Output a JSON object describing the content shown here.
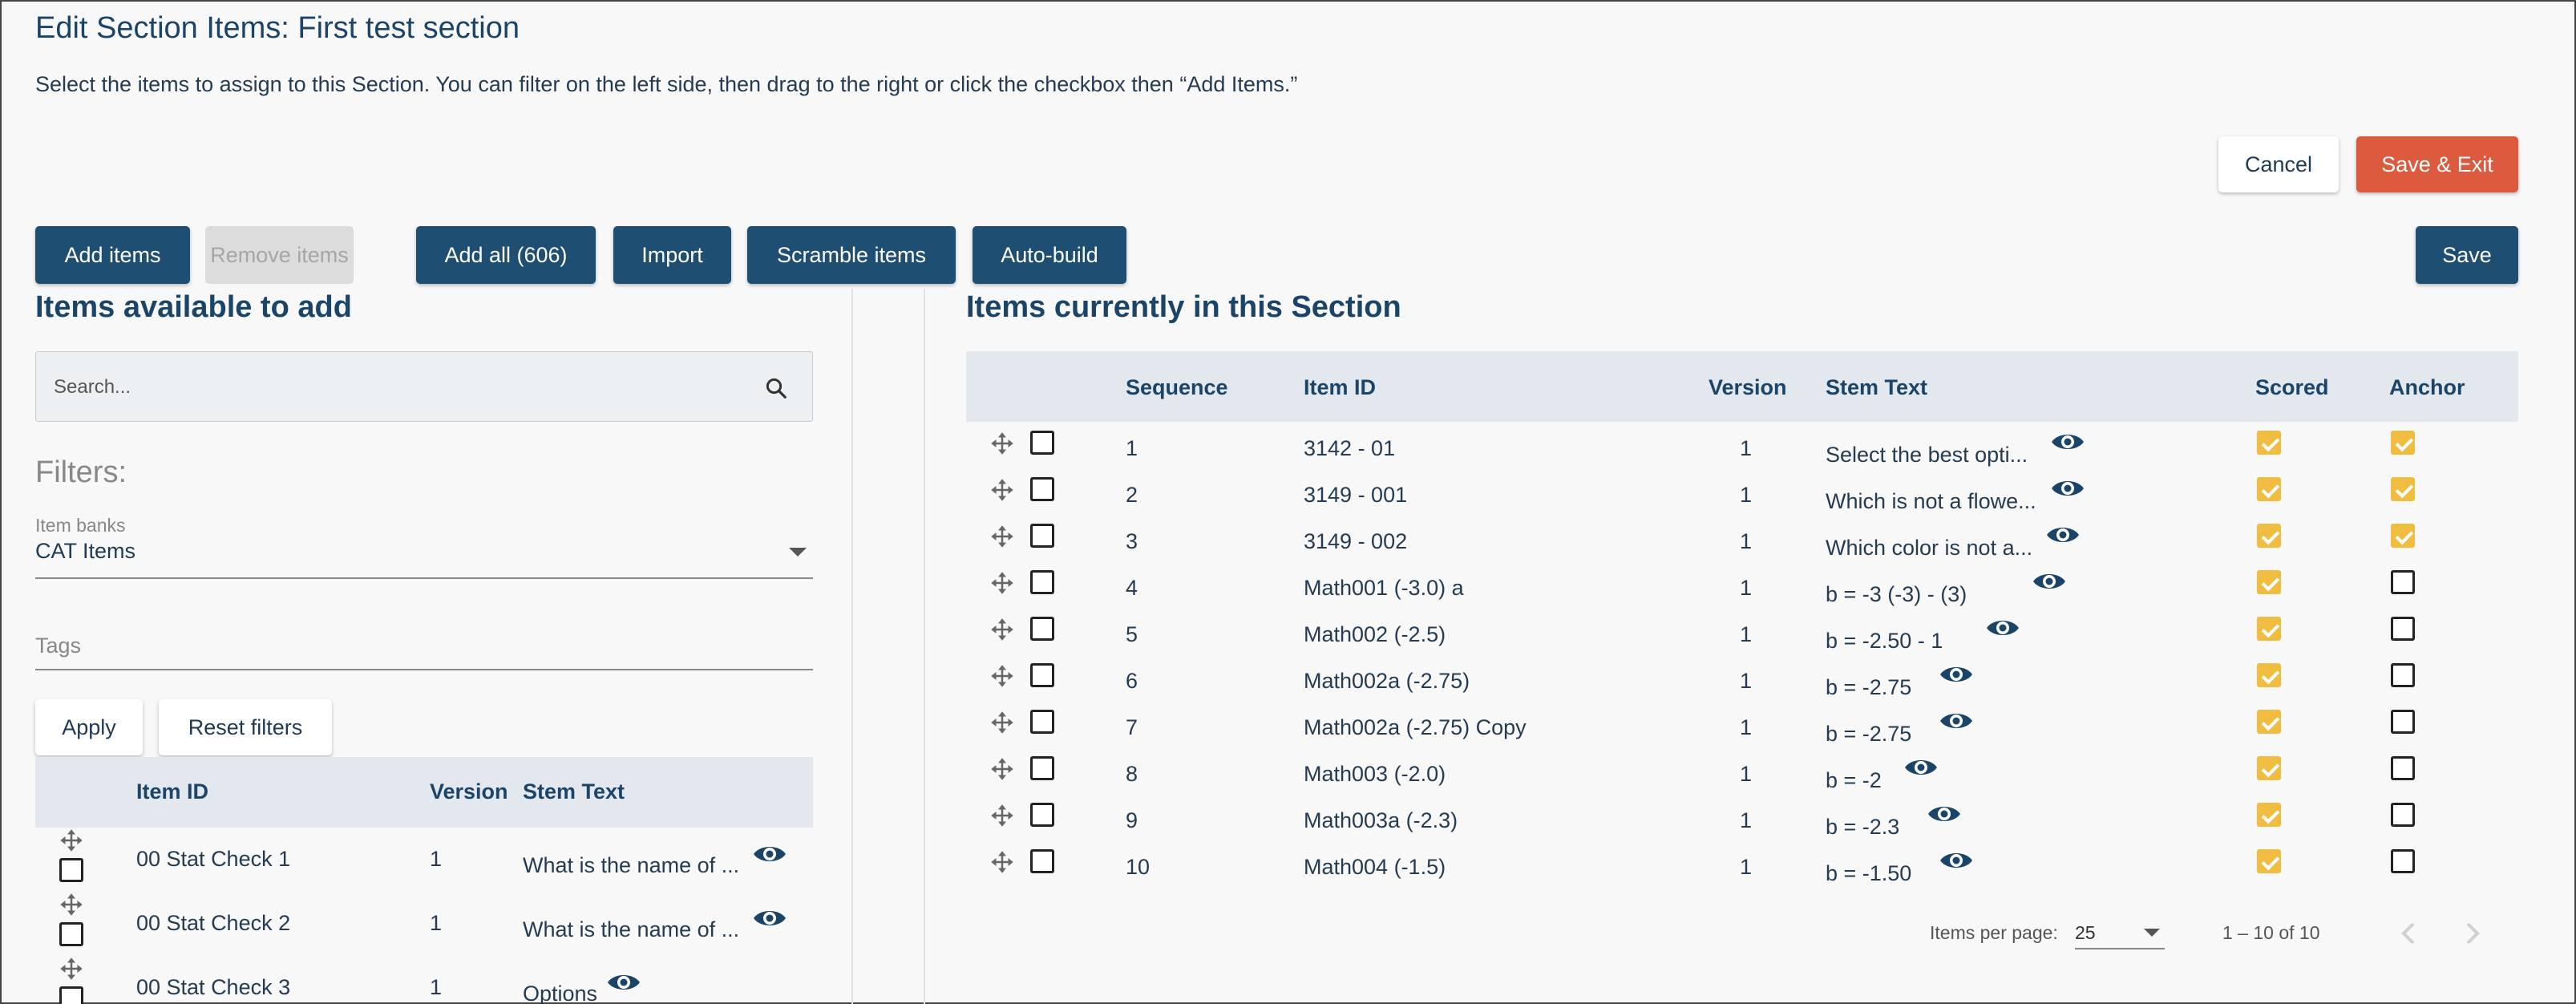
{
  "header": {
    "title": "Edit Section Items: First test section",
    "subtitle": "Select the items to assign to this Section. You can filter on the left side, then drag to the right or click the checkbox then “Add Items.”"
  },
  "actions": {
    "cancel": "Cancel",
    "save_exit": "Save & Exit",
    "save": "Save"
  },
  "toolbar": {
    "add_items": "Add items",
    "remove_items": "Remove items",
    "add_all": "Add all (606)",
    "import": "Import",
    "scramble": "Scramble items",
    "auto_build": "Auto-build"
  },
  "left": {
    "title": "Items available to add",
    "search_placeholder": "Search...",
    "filters_label": "Filters:",
    "item_banks_label": "Item banks",
    "item_banks_value": "CAT Items",
    "tags_placeholder": "Tags",
    "apply": "Apply",
    "reset": "Reset filters",
    "columns": {
      "item_id": "Item ID",
      "version": "Version",
      "stem_text": "Stem Text"
    },
    "rows": [
      {
        "item_id": "00 Stat Check 1",
        "version": "1",
        "stem": "What is the name of ..."
      },
      {
        "item_id": "00 Stat Check 2",
        "version": "1",
        "stem": "What is the name of ..."
      },
      {
        "item_id": "00 Stat Check 3",
        "version": "1",
        "stem": "Options"
      }
    ]
  },
  "right": {
    "title": "Items currently in this Section",
    "columns": {
      "sequence": "Sequence",
      "item_id": "Item ID",
      "version": "Version",
      "stem_text": "Stem Text",
      "scored": "Scored",
      "anchor": "Anchor"
    },
    "rows": [
      {
        "seq": "1",
        "item_id": "3142 - 01",
        "version": "1",
        "stem": "Select the best opti...",
        "scored": true,
        "anchor": true
      },
      {
        "seq": "2",
        "item_id": "3149 - 001",
        "version": "1",
        "stem": "Which is not a flowe...",
        "scored": true,
        "anchor": true
      },
      {
        "seq": "3",
        "item_id": "3149 - 002",
        "version": "1",
        "stem": "Which color is not a...",
        "scored": true,
        "anchor": true
      },
      {
        "seq": "4",
        "item_id": "Math001 (-3.0) a",
        "version": "1",
        "stem": "b = -3 (-3) - (3)",
        "scored": true,
        "anchor": false
      },
      {
        "seq": "5",
        "item_id": "Math002 (-2.5)",
        "version": "1",
        "stem": "b = -2.50 - 1",
        "scored": true,
        "anchor": false
      },
      {
        "seq": "6",
        "item_id": "Math002a (-2.75)",
        "version": "1",
        "stem": "b = -2.75",
        "scored": true,
        "anchor": false
      },
      {
        "seq": "7",
        "item_id": "Math002a (-2.75) Copy",
        "version": "1",
        "stem": "b = -2.75",
        "scored": true,
        "anchor": false
      },
      {
        "seq": "8",
        "item_id": "Math003 (-2.0)",
        "version": "1",
        "stem": "b = -2",
        "scored": true,
        "anchor": false
      },
      {
        "seq": "9",
        "item_id": "Math003a (-2.3)",
        "version": "1",
        "stem": "b = -2.3",
        "scored": true,
        "anchor": false
      },
      {
        "seq": "10",
        "item_id": "Math004 (-1.5)",
        "version": "1",
        "stem": "b = -1.50",
        "scored": true,
        "anchor": false
      }
    ],
    "pagination": {
      "per_page_label": "Items per page:",
      "per_page_value": "25",
      "range": "1 – 10 of 10"
    }
  },
  "colors": {
    "primary": "#1f4e73",
    "danger": "#dc5a3d",
    "checked": "#f0bd40",
    "table_header": "#e3e8ef"
  }
}
